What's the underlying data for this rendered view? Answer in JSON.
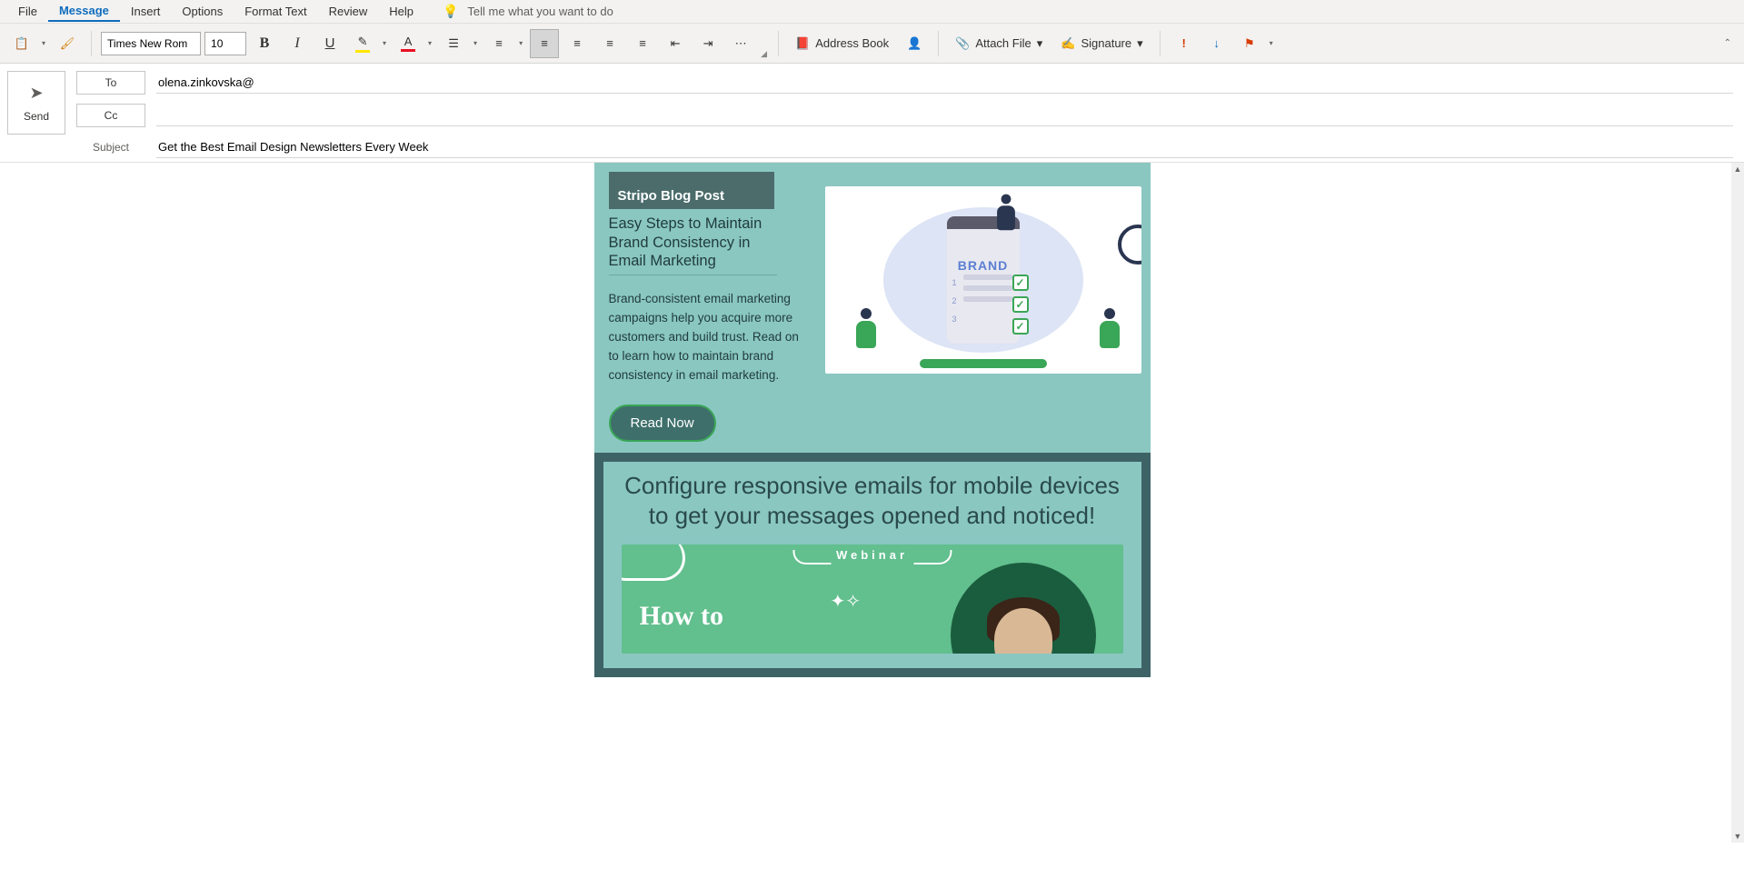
{
  "menu": {
    "file": "File",
    "message": "Message",
    "insert": "Insert",
    "options": "Options",
    "format_text": "Format Text",
    "review": "Review",
    "help": "Help",
    "tell_me": "Tell me what you want to do"
  },
  "ribbon": {
    "font_name": "Times New Rom",
    "font_size": "10",
    "address_book": "Address Book",
    "attach_file": "Attach File",
    "signature": "Signature"
  },
  "header": {
    "send": "Send",
    "to_label": "To",
    "to_value": "olena.zinkovska@",
    "cc_label": "Cc",
    "cc_value": "",
    "subject_label": "Subject",
    "subject_value": "Get the Best Email Design Newsletters Every Week"
  },
  "email": {
    "badge": "Stripo Blog Post",
    "card_title": "Easy Steps to Maintain Brand Consistency in Email Marketing",
    "card_desc": "Brand-consistent email marketing campaigns help you acquire more customers and build trust. Read on to learn how to maintain brand consistency in email marketing.",
    "read_now": "Read Now",
    "illus_brand": "BRAND",
    "section2_title": "Configure responsive emails for mobile devices to get your messages opened and noticed!",
    "webinar_tag": "Webinar",
    "howto": "How to"
  }
}
